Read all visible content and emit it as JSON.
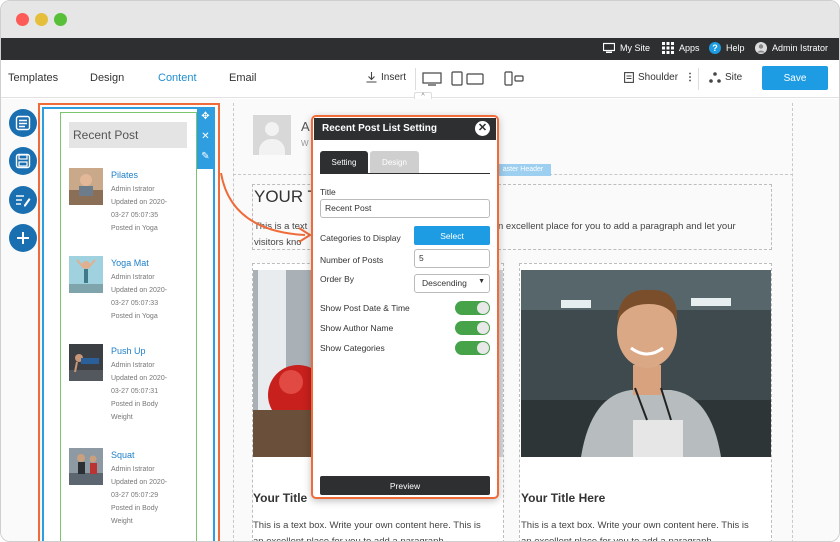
{
  "topbar": {
    "my_site": "My Site",
    "apps": "Apps",
    "help": "Help",
    "user": "Admin Istrator"
  },
  "toolbar": {
    "templates": "Templates",
    "design": "Design",
    "content": "Content",
    "email": "Email",
    "insert": "Insert",
    "page_name": "Shoulder",
    "site": "Site",
    "save": "Save"
  },
  "sidebar_widget": {
    "title": "Recent Post",
    "posts": [
      {
        "title": "Pilates",
        "author": "Admin Istrator",
        "updated": "Updated on 2020-",
        "updated2": "03-27 05:07:35",
        "category": "Posted in Yoga",
        "category2": ""
      },
      {
        "title": "Yoga Mat",
        "author": "Admin Istrator",
        "updated": "Updated on 2020-",
        "updated2": "03-27 05:07:33",
        "category": "Posted in Yoga",
        "category2": ""
      },
      {
        "title": "Push Up",
        "author": "Admin Istrator",
        "updated": "Updated on 2020-",
        "updated2": "03-27 05:07:31",
        "category": "Posted in Body",
        "category2": "Weight"
      },
      {
        "title": "Squat",
        "author": "Admin Istrator",
        "updated": "Updated on 2020-",
        "updated2": "03-27 05:07:29",
        "category": "Posted in Body",
        "category2": "Weight"
      }
    ]
  },
  "page": {
    "header_name": "A",
    "header_sub": "W",
    "master_tag": "aster Header",
    "title": "YOUR TI",
    "intro_1": "This is a text",
    "intro_2": "n excellent place for you to add a paragraph and let your",
    "intro_3": "visitors kno",
    "cards": [
      {
        "title": "Your Title",
        "text_1": "This is a text box. Write your own content here. This is",
        "text_2": "an excellent place for you to add a paragraph"
      },
      {
        "title": "Your Title Here",
        "text_1": "This is a text box. Write your own content here. This is",
        "text_2": "an excellent place for you to add a paragraph"
      }
    ]
  },
  "modal": {
    "title": "Recent Post List Setting",
    "tab_setting": "Setting",
    "tab_design": "Design",
    "title_label": "Title",
    "title_value": "Recent Post",
    "categories_label": "Categories to Display",
    "select_button": "Select",
    "num_posts_label": "Number of Posts",
    "num_posts_value": "5",
    "order_by_label": "Order By",
    "order_by_value": "Descending",
    "show_date_label": "Show Post Date & Time",
    "show_author_label": "Show Author Name",
    "show_categories_label": "Show Categories",
    "preview_button": "Preview"
  },
  "colors": {
    "accent_blue": "#1e9ce3",
    "highlight_orange": "#ef6b3a",
    "toggle_green": "#47a34a",
    "dark_bar": "#2d2f31"
  }
}
